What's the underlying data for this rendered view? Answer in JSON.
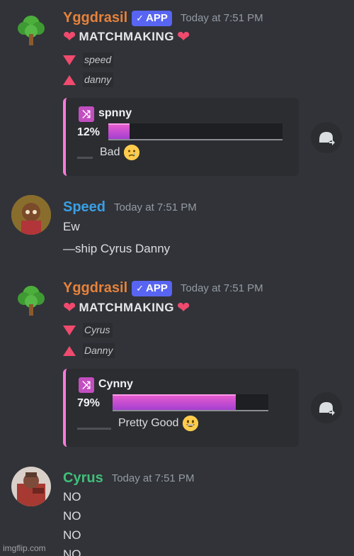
{
  "messages": [
    {
      "author": "Yggdrasil",
      "author_color": "#e6823b",
      "badge": "APP",
      "timestamp": "Today at 7:51 PM",
      "heading": "MATCHMAKING",
      "down_name": "speed",
      "up_name": "danny",
      "embed": {
        "ship_name": "spnny",
        "percent_label": "12%",
        "percent": 12,
        "rating": "Bad"
      }
    },
    {
      "author": "Speed",
      "author_color": "#3aa0e4",
      "timestamp": "Today at 7:51 PM",
      "lines": [
        "Ew",
        "—ship Cyrus Danny"
      ]
    },
    {
      "author": "Yggdrasil",
      "author_color": "#e6823b",
      "badge": "APP",
      "timestamp": "Today at 7:51 PM",
      "heading": "MATCHMAKING",
      "down_name": "Cyrus",
      "up_name": "Danny",
      "embed": {
        "ship_name": "Cynny",
        "percent_label": "79%",
        "percent": 79,
        "rating": "Pretty Good"
      }
    },
    {
      "author": "Cyrus",
      "author_color": "#3fc07a",
      "timestamp": "Today at 7:51 PM",
      "lines": [
        "NO",
        "NO",
        "NO",
        "NO"
      ]
    }
  ],
  "watermark": "imgflip.com",
  "icons": {
    "tree": "tree-avatar-icon",
    "shuffle": "shuffle-icon",
    "reply": "add-reaction-icon"
  }
}
